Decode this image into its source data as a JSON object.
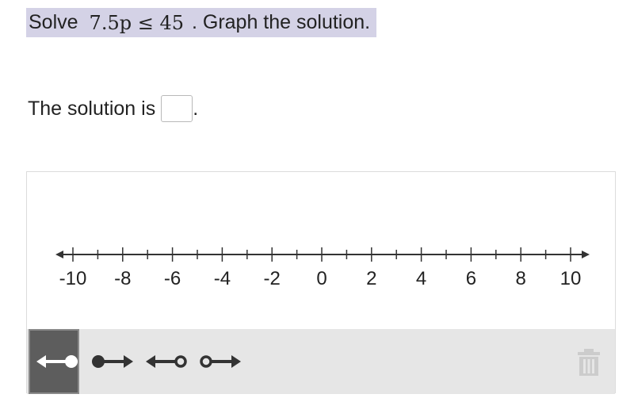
{
  "question": {
    "prefix": "Solve",
    "math": "7.5p ≤ 45",
    "suffix": ". Graph the solution."
  },
  "answer": {
    "label": "The solution is",
    "value": "",
    "period": "."
  },
  "numberline": {
    "min": -10,
    "max": 10,
    "major_step": 2,
    "minor_step": 1,
    "tick_labels": [
      "-10",
      "-8",
      "-6",
      "-4",
      "-2",
      "0",
      "2",
      "4",
      "6",
      "8",
      "10"
    ]
  },
  "toolbar": {
    "selected_tool": "closed-left-ray",
    "tools": [
      {
        "name": "closed-left-ray-icon"
      },
      {
        "name": "closed-right-ray-icon"
      },
      {
        "name": "open-left-ray-icon"
      },
      {
        "name": "open-right-ray-icon"
      }
    ],
    "trash_icon": "trash-icon"
  },
  "colors": {
    "question_highlight": "#d4d2e6",
    "toolbar_bg": "#e6e6e6",
    "selected_tool_bg": "#5d5d5d",
    "icon_dark": "#333333",
    "trash_disabled": "#cccccc"
  }
}
